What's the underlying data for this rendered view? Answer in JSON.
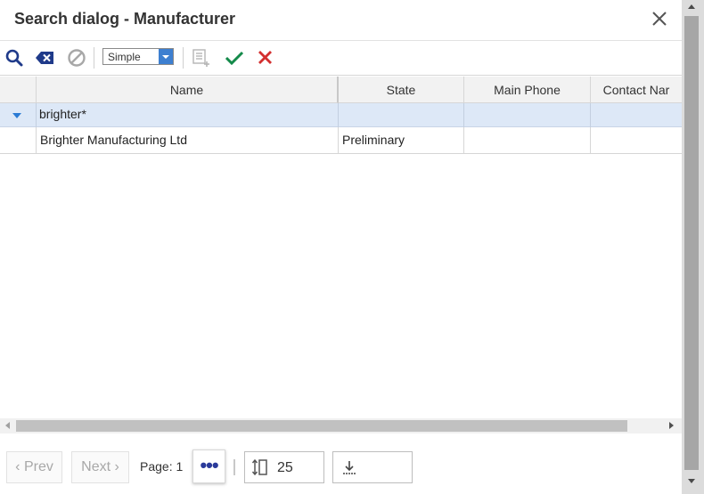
{
  "dialog": {
    "title": "Search dialog - Manufacturer"
  },
  "toolbar": {
    "icons": [
      "search-icon",
      "clear-icon",
      "cancel-search-icon",
      "add-to-list-icon",
      "check-icon",
      "x-icon"
    ],
    "mode_select": {
      "value": "Simple"
    },
    "colors": {
      "primary": "#1f3a8a",
      "ok": "#148a4a",
      "cancel": "#d32f2f",
      "filter_row": "#dde8f7"
    }
  },
  "grid": {
    "columns": [
      "Name",
      "State",
      "Main Phone",
      "Contact Nar"
    ],
    "filter_row": {
      "name": "brighter*",
      "state": "",
      "main_phone": "",
      "contact_name": ""
    },
    "rows": [
      {
        "name": "Brighter Manufacturing Ltd",
        "state": "Preliminary",
        "main_phone": "",
        "contact_name": ""
      }
    ]
  },
  "pager": {
    "prev_label": "Prev",
    "next_label": "Next",
    "page_label": "Page: 1",
    "more_label": "•••",
    "page_size": "25"
  }
}
